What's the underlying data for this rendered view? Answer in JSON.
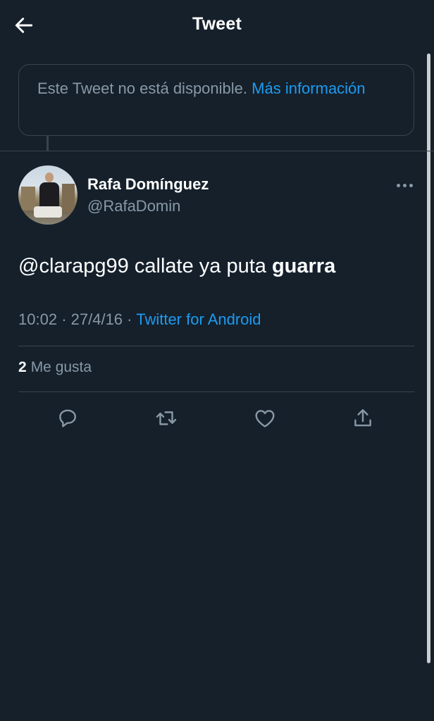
{
  "header": {
    "title": "Tweet",
    "back_icon": "arrow-left-icon"
  },
  "notice": {
    "text": "Este Tweet no está disponible.",
    "link": "Más información"
  },
  "author": {
    "name": "Rafa Domínguez",
    "handle": "@RafaDomin"
  },
  "tweet": {
    "text_plain": "@clarapg99 callate ya puta ",
    "text_bold": "guarra"
  },
  "meta": {
    "time": "10:02",
    "separator": "·",
    "date": "27/4/16",
    "source": "Twitter for Android"
  },
  "stats": {
    "likes_count": "2",
    "likes_label": "Me gusta"
  },
  "actions": [
    "reply-icon",
    "retweet-icon",
    "like-icon",
    "share-icon"
  ],
  "colors": {
    "background": "#15202b",
    "accent": "#1d9bf0",
    "secondary_text": "#8899a6",
    "border": "#38444d"
  }
}
